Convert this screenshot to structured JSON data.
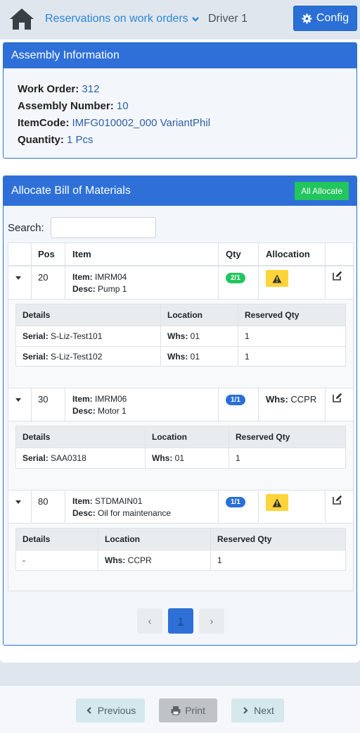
{
  "nav": {
    "title": "Reservations on work orders",
    "user": "Driver 1",
    "config_label": "Config"
  },
  "assembly": {
    "header": "Assembly Information",
    "fields": [
      {
        "label": "Work Order:",
        "value": "312"
      },
      {
        "label": "Assembly Number:",
        "value": "10"
      },
      {
        "label": "ItemCode:",
        "value": "IMFG010002_000 VariantPhil"
      },
      {
        "label": "Quantity:",
        "value": "1 Pcs"
      }
    ]
  },
  "bom": {
    "header": "Allocate Bill of Materials",
    "all_allocate_label": "All Allocate",
    "search_label": "Search:",
    "search_value": "",
    "columns": [
      "Pos",
      "Item",
      "Qty",
      "Allocation"
    ],
    "item_label": "Item:",
    "desc_label": "Desc:",
    "detail_columns": [
      "Details",
      "Location",
      "Reserved Qty"
    ],
    "rows": [
      {
        "pos": "20",
        "item": "IMRM04",
        "desc": "Pump 1",
        "qty": "2/1",
        "qty_color": "#22c55e",
        "allocation": "warning",
        "details": [
          {
            "detail_label": "Serial:",
            "detail": "S-Liz-Test101",
            "loc_label": "Whs:",
            "location": "01",
            "reserved": "1"
          },
          {
            "detail_label": "Serial:",
            "detail": "S-Liz-Test102",
            "loc_label": "Whs:",
            "location": "01",
            "reserved": "1"
          }
        ]
      },
      {
        "pos": "30",
        "item": "IMRM06",
        "desc": "Motor 1",
        "qty": "1/1",
        "qty_color": "#2a6fd6",
        "allocation_label": "Whs:",
        "allocation_value": "CCPR",
        "details": [
          {
            "detail_label": "Serial:",
            "detail": "SAA0318",
            "loc_label": "Whs:",
            "location": "01",
            "reserved": "1"
          }
        ]
      },
      {
        "pos": "80",
        "item": "STDMAIN01",
        "desc": "Oil for maintenance",
        "qty": "1/1",
        "qty_color": "#2a6fd6",
        "allocation": "warning",
        "details": [
          {
            "detail_label": "",
            "detail": "-",
            "loc_label": "Whs:",
            "location": "CCPR",
            "reserved": "1"
          }
        ]
      }
    ],
    "pager": {
      "prev": "‹",
      "current": "1",
      "next": "›"
    }
  },
  "footer": {
    "previous_label": "Previous",
    "print_label": "Print",
    "next_label": "Next"
  },
  "icons": {
    "home": "home-icon",
    "config": "gear-icon",
    "warning": "warning-icon",
    "edit": "edit-icon"
  },
  "colors": {
    "primary": "#2e70d8",
    "success": "#22c55e",
    "warning": "#ffd43b",
    "link": "#2a86d8"
  }
}
